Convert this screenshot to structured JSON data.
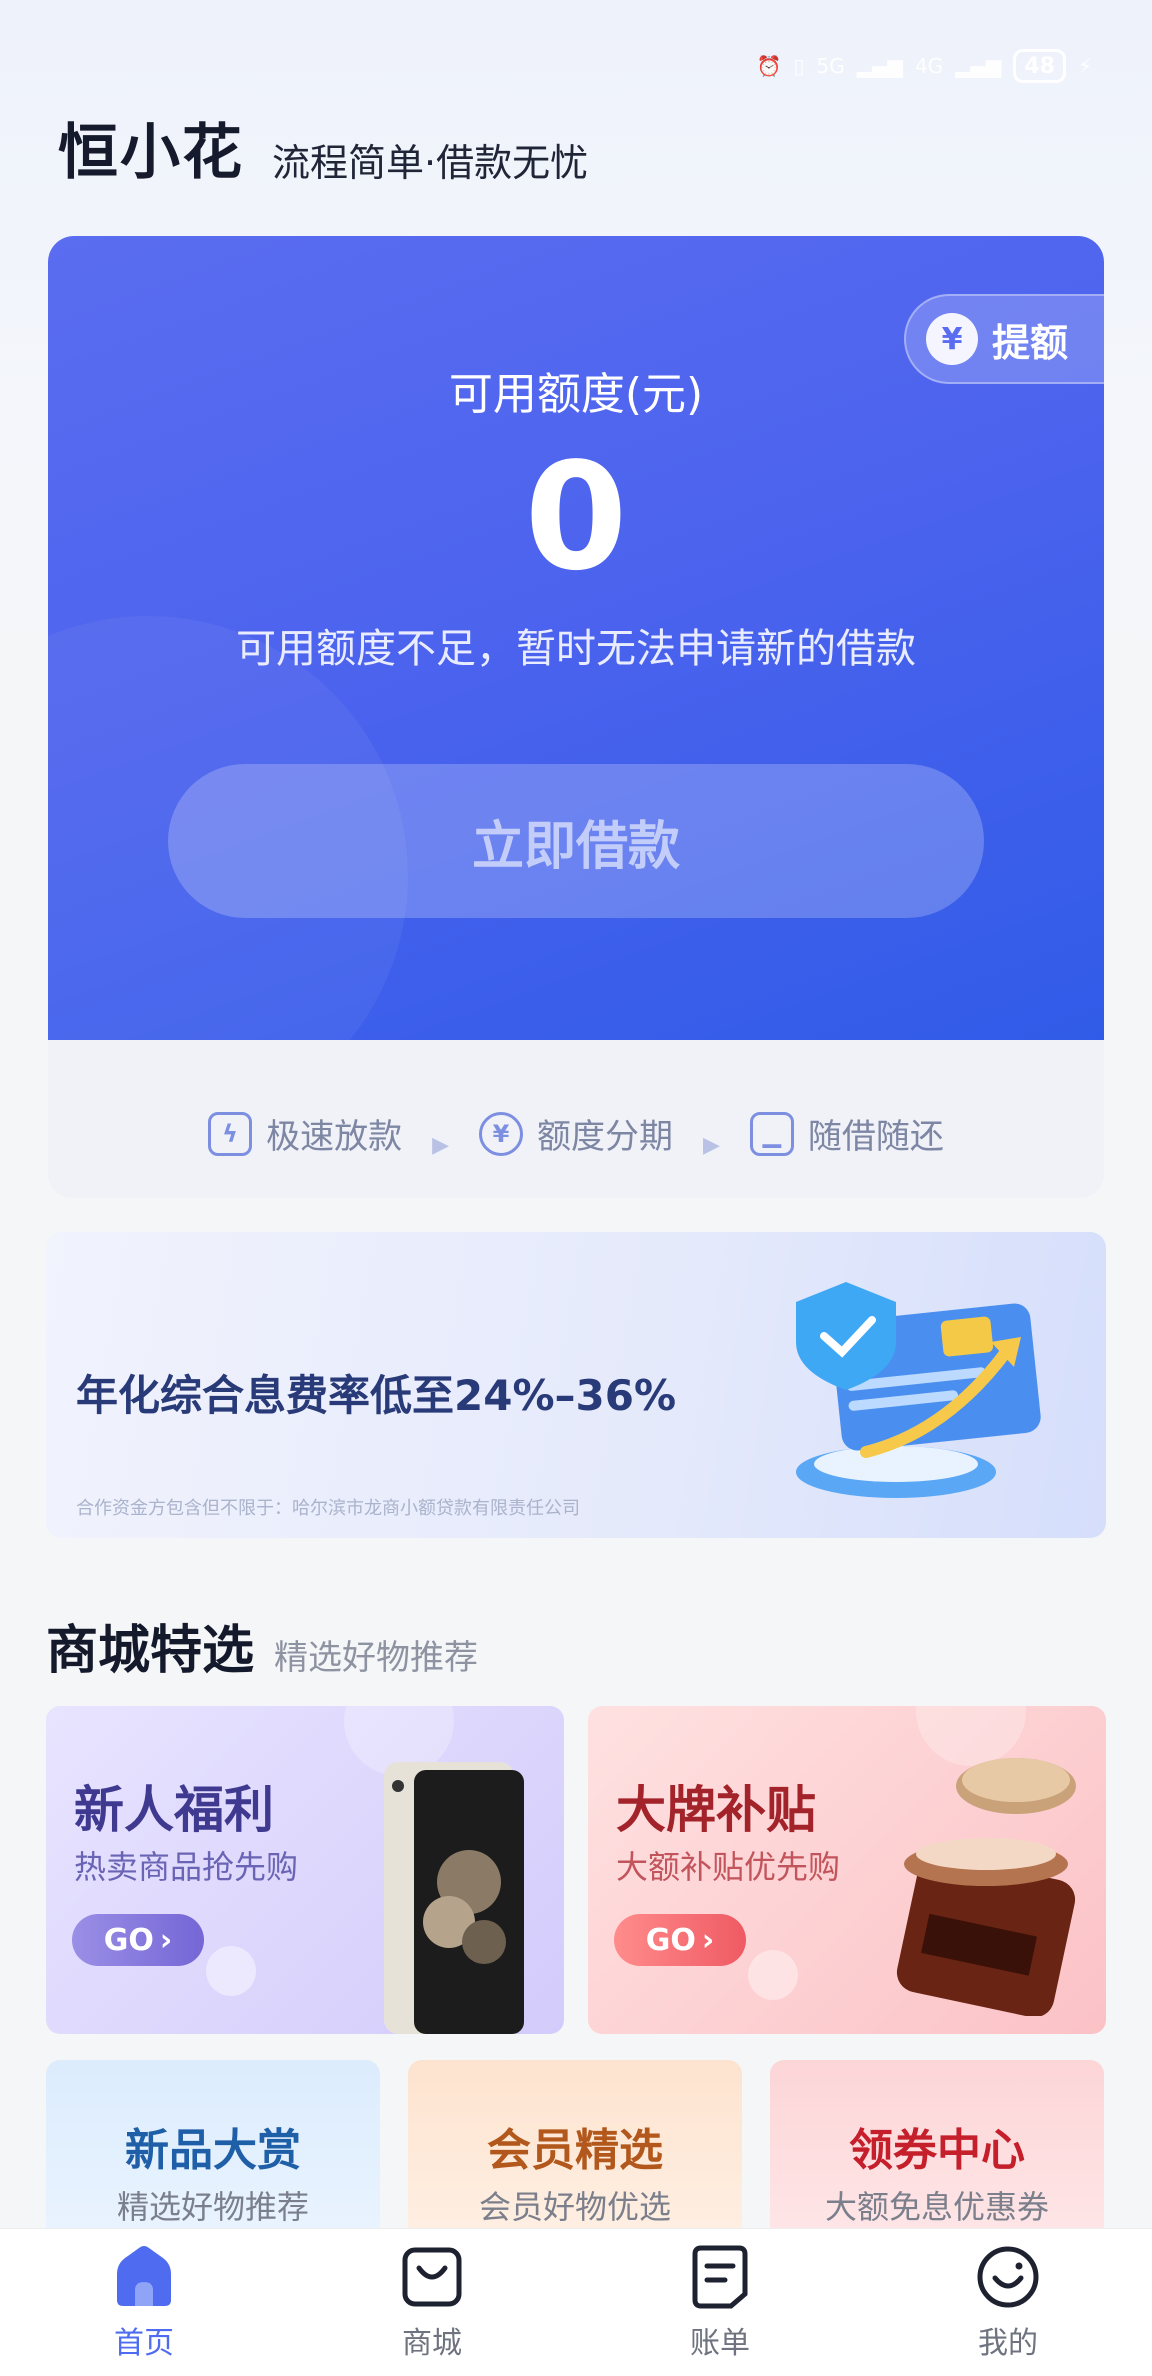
{
  "app": {
    "logo_text": "恒小花",
    "slogan": "流程简单·借款无忧"
  },
  "status_bar": {
    "network_1": "5G",
    "network_2": "4G",
    "battery": "48"
  },
  "credit": {
    "raise_label": "提额",
    "raise_icon": "yen-circle-icon",
    "title": "可用额度(元)",
    "amount": "0",
    "note": "可用额度不足，暂时无法申请新的借款",
    "borrow_button": "立即借款"
  },
  "features": [
    {
      "label": "极速放款",
      "icon": "shield-lightning-icon"
    },
    {
      "label": "额度分期",
      "icon": "yen-circle-icon"
    },
    {
      "label": "随借随还",
      "icon": "phone-icon"
    }
  ],
  "rate_banner": {
    "text": "年化综合息费率低至24%–36%",
    "sub": "合作资金方包含但不限于：哈尔滨市龙商小额贷款有限责任公司",
    "illustration": "credit-card-shield-icon"
  },
  "mall": {
    "title": "商城特选",
    "subtitle": "精选好物推荐",
    "promos": [
      {
        "title": "新人福利",
        "sub": "热卖商品抢先购",
        "go": "GO",
        "image": "tablet-icon"
      },
      {
        "title": "大牌补贴",
        "sub": "大额补贴优先购",
        "go": "GO",
        "image": "cosmetic-jar-icon"
      }
    ],
    "tiles": [
      {
        "title": "新品大赏",
        "sub": "精选好物推荐"
      },
      {
        "title": "会员精选",
        "sub": "会员好物优选"
      },
      {
        "title": "领券中心",
        "sub": "大额免息优惠券"
      }
    ]
  },
  "bottom_nav": [
    {
      "label": "首页",
      "icon": "home-icon",
      "active": true
    },
    {
      "label": "商城",
      "icon": "shop-bag-icon",
      "active": false
    },
    {
      "label": "账单",
      "icon": "bill-icon",
      "active": false
    },
    {
      "label": "我的",
      "icon": "smile-icon",
      "active": false
    }
  ],
  "colors": {
    "accent": "#4f6cf0",
    "card_start": "#5a6df0",
    "card_end": "#2f5be8"
  }
}
